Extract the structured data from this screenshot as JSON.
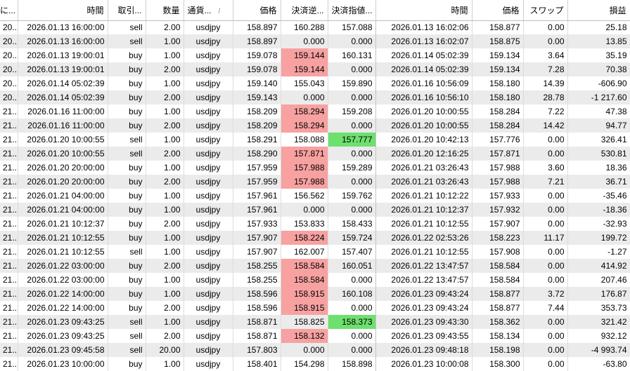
{
  "columns": {
    "order": "に...",
    "time": "時間",
    "type": "取引...",
    "volume": "数量",
    "symbol": "通貨...",
    "sort_glyph": "/",
    "price": "価格",
    "sl": "決済逆...",
    "tp": "決済指値...",
    "close_time": "時間",
    "close_price": "価格",
    "swap": "スワップ",
    "profit": "損益"
  },
  "colors": {
    "stop_loss_highlight": "#f7a1a1",
    "take_profit_highlight": "#6ee06e",
    "alt_row": "#ebebeb"
  },
  "rows": [
    {
      "order": "20...",
      "time": "2026.01.13 16:00:00",
      "type": "sell",
      "volume": "2.00",
      "symbol": "usdjpy",
      "price": "158.897",
      "sl": "160.288",
      "tp": "157.088",
      "close_time": "2026.01.13 16:02:06",
      "close_price": "158.877",
      "swap": "0.00",
      "profit": "25.18",
      "sl_hl": "",
      "tp_hl": ""
    },
    {
      "order": "20...",
      "time": "2026.01.13 16:00:00",
      "type": "sell",
      "volume": "1.00",
      "symbol": "usdjpy",
      "price": "158.897",
      "sl": "0.000",
      "tp": "0.000",
      "close_time": "2026.01.13 16:02:07",
      "close_price": "158.875",
      "swap": "0.00",
      "profit": "13.85",
      "sl_hl": "",
      "tp_hl": ""
    },
    {
      "order": "20...",
      "time": "2026.01.13 19:00:01",
      "type": "buy",
      "volume": "1.00",
      "symbol": "usdjpy",
      "price": "159.078",
      "sl": "159.144",
      "tp": "160.131",
      "close_time": "2026.01.14 05:02:39",
      "close_price": "159.134",
      "swap": "3.64",
      "profit": "35.19",
      "sl_hl": "red",
      "tp_hl": ""
    },
    {
      "order": "20...",
      "time": "2026.01.13 19:00:01",
      "type": "buy",
      "volume": "2.00",
      "symbol": "usdjpy",
      "price": "159.078",
      "sl": "159.144",
      "tp": "0.000",
      "close_time": "2026.01.14 05:02:39",
      "close_price": "159.134",
      "swap": "7.28",
      "profit": "70.38",
      "sl_hl": "red",
      "tp_hl": ""
    },
    {
      "order": "20...",
      "time": "2026.01.14 05:02:39",
      "type": "buy",
      "volume": "1.00",
      "symbol": "usdjpy",
      "price": "159.140",
      "sl": "155.043",
      "tp": "159.890",
      "close_time": "2026.01.16 10:56:09",
      "close_price": "158.180",
      "swap": "14.39",
      "profit": "-606.90",
      "sl_hl": "",
      "tp_hl": ""
    },
    {
      "order": "20...",
      "time": "2026.01.14 05:02:39",
      "type": "buy",
      "volume": "2.00",
      "symbol": "usdjpy",
      "price": "159.143",
      "sl": "0.000",
      "tp": "0.000",
      "close_time": "2026.01.16 10:56:10",
      "close_price": "158.180",
      "swap": "28.78",
      "profit": "-1 217.60",
      "sl_hl": "",
      "tp_hl": ""
    },
    {
      "order": "21...",
      "time": "2026.01.16 11:00:00",
      "type": "buy",
      "volume": "1.00",
      "symbol": "usdjpy",
      "price": "158.209",
      "sl": "158.294",
      "tp": "159.208",
      "close_time": "2026.01.20 10:00:55",
      "close_price": "158.284",
      "swap": "7.22",
      "profit": "47.38",
      "sl_hl": "red",
      "tp_hl": ""
    },
    {
      "order": "21...",
      "time": "2026.01.16 11:00:00",
      "type": "buy",
      "volume": "2.00",
      "symbol": "usdjpy",
      "price": "158.209",
      "sl": "158.294",
      "tp": "0.000",
      "close_time": "2026.01.20 10:00:55",
      "close_price": "158.284",
      "swap": "14.42",
      "profit": "94.77",
      "sl_hl": "red",
      "tp_hl": ""
    },
    {
      "order": "21...",
      "time": "2026.01.20 10:00:55",
      "type": "sell",
      "volume": "1.00",
      "symbol": "usdjpy",
      "price": "158.291",
      "sl": "158.088",
      "tp": "157.777",
      "close_time": "2026.01.20 10:42:13",
      "close_price": "157.776",
      "swap": "0.00",
      "profit": "326.41",
      "sl_hl": "",
      "tp_hl": "green"
    },
    {
      "order": "21...",
      "time": "2026.01.20 10:00:55",
      "type": "sell",
      "volume": "2.00",
      "symbol": "usdjpy",
      "price": "158.290",
      "sl": "157.871",
      "tp": "0.000",
      "close_time": "2026.01.20 12:16:25",
      "close_price": "157.871",
      "swap": "0.00",
      "profit": "530.81",
      "sl_hl": "red",
      "tp_hl": ""
    },
    {
      "order": "21...",
      "time": "2026.01.20 20:00:00",
      "type": "buy",
      "volume": "1.00",
      "symbol": "usdjpy",
      "price": "157.959",
      "sl": "157.988",
      "tp": "159.289",
      "close_time": "2026.01.21 03:26:43",
      "close_price": "157.988",
      "swap": "3.60",
      "profit": "18.36",
      "sl_hl": "red",
      "tp_hl": ""
    },
    {
      "order": "21...",
      "time": "2026.01.20 20:00:00",
      "type": "buy",
      "volume": "2.00",
      "symbol": "usdjpy",
      "price": "157.959",
      "sl": "157.988",
      "tp": "0.000",
      "close_time": "2026.01.21 03:26:43",
      "close_price": "157.988",
      "swap": "7.21",
      "profit": "36.71",
      "sl_hl": "red",
      "tp_hl": ""
    },
    {
      "order": "21...",
      "time": "2026.01.21 04:00:00",
      "type": "buy",
      "volume": "1.00",
      "symbol": "usdjpy",
      "price": "157.961",
      "sl": "156.562",
      "tp": "159.762",
      "close_time": "2026.01.21 10:12:22",
      "close_price": "157.933",
      "swap": "0.00",
      "profit": "-35.46",
      "sl_hl": "",
      "tp_hl": ""
    },
    {
      "order": "21...",
      "time": "2026.01.21 04:00:00",
      "type": "buy",
      "volume": "1.00",
      "symbol": "usdjpy",
      "price": "157.961",
      "sl": "0.000",
      "tp": "0.000",
      "close_time": "2026.01.21 10:12:37",
      "close_price": "157.932",
      "swap": "0.00",
      "profit": "-18.36",
      "sl_hl": "",
      "tp_hl": ""
    },
    {
      "order": "21...",
      "time": "2026.01.21 10:12:37",
      "type": "buy",
      "volume": "2.00",
      "symbol": "usdjpy",
      "price": "157.933",
      "sl": "153.833",
      "tp": "158.433",
      "close_time": "2026.01.21 10:12:55",
      "close_price": "157.907",
      "swap": "0.00",
      "profit": "-32.93",
      "sl_hl": "",
      "tp_hl": ""
    },
    {
      "order": "21...",
      "time": "2026.01.21 10:12:55",
      "type": "buy",
      "volume": "1.00",
      "symbol": "usdjpy",
      "price": "157.907",
      "sl": "158.224",
      "tp": "159.724",
      "close_time": "2026.01.22 02:53:26",
      "close_price": "158.223",
      "swap": "11.17",
      "profit": "199.72",
      "sl_hl": "red",
      "tp_hl": ""
    },
    {
      "order": "21...",
      "time": "2026.01.21 10:12:55",
      "type": "sell",
      "volume": "1.00",
      "symbol": "usdjpy",
      "price": "157.907",
      "sl": "162.007",
      "tp": "157.407",
      "close_time": "2026.01.21 10:12:55",
      "close_price": "157.908",
      "swap": "0.00",
      "profit": "-1.27",
      "sl_hl": "",
      "tp_hl": ""
    },
    {
      "order": "21...",
      "time": "2026.01.22 03:00:00",
      "type": "buy",
      "volume": "2.00",
      "symbol": "usdjpy",
      "price": "158.255",
      "sl": "158.584",
      "tp": "160.051",
      "close_time": "2026.01.22 13:47:57",
      "close_price": "158.584",
      "swap": "0.00",
      "profit": "414.92",
      "sl_hl": "red",
      "tp_hl": ""
    },
    {
      "order": "21...",
      "time": "2026.01.22 03:00:00",
      "type": "buy",
      "volume": "1.00",
      "symbol": "usdjpy",
      "price": "158.255",
      "sl": "158.584",
      "tp": "0.000",
      "close_time": "2026.01.22 13:47:57",
      "close_price": "158.584",
      "swap": "0.00",
      "profit": "207.46",
      "sl_hl": "red",
      "tp_hl": ""
    },
    {
      "order": "21...",
      "time": "2026.01.22 14:00:00",
      "type": "buy",
      "volume": "1.00",
      "symbol": "usdjpy",
      "price": "158.596",
      "sl": "158.915",
      "tp": "160.108",
      "close_time": "2026.01.23 09:43:24",
      "close_price": "158.877",
      "swap": "3.72",
      "profit": "176.87",
      "sl_hl": "red",
      "tp_hl": ""
    },
    {
      "order": "21...",
      "time": "2026.01.22 14:00:00",
      "type": "buy",
      "volume": "2.00",
      "symbol": "usdjpy",
      "price": "158.596",
      "sl": "158.915",
      "tp": "0.000",
      "close_time": "2026.01.23 09:43:24",
      "close_price": "158.877",
      "swap": "7.44",
      "profit": "353.73",
      "sl_hl": "red",
      "tp_hl": ""
    },
    {
      "order": "21...",
      "time": "2026.01.23 09:43:25",
      "type": "sell",
      "volume": "1.00",
      "symbol": "usdjpy",
      "price": "158.871",
      "sl": "158.825",
      "tp": "158.373",
      "close_time": "2026.01.23 09:43:30",
      "close_price": "158.362",
      "swap": "0.00",
      "profit": "321.42",
      "sl_hl": "",
      "tp_hl": "green"
    },
    {
      "order": "21...",
      "time": "2026.01.23 09:43:25",
      "type": "sell",
      "volume": "2.00",
      "symbol": "usdjpy",
      "price": "158.871",
      "sl": "158.132",
      "tp": "0.000",
      "close_time": "2026.01.23 09:43:55",
      "close_price": "158.134",
      "swap": "0.00",
      "profit": "932.12",
      "sl_hl": "red",
      "tp_hl": ""
    },
    {
      "order": "21...",
      "time": "2026.01.23 09:45:58",
      "type": "sell",
      "volume": "20.00",
      "symbol": "usdjpy",
      "price": "157.803",
      "sl": "0.000",
      "tp": "0.000",
      "close_time": "2026.01.23 09:48:18",
      "close_price": "158.198",
      "swap": "0.00",
      "profit": "-4 993.74",
      "sl_hl": "",
      "tp_hl": ""
    },
    {
      "order": "21...",
      "time": "2026.01.23 10:00:00",
      "type": "buy",
      "volume": "1.00",
      "symbol": "usdjpy",
      "price": "158.401",
      "sl": "154.298",
      "tp": "158.898",
      "close_time": "2026.01.23 10:00:08",
      "close_price": "158.300",
      "swap": "0.00",
      "profit": "-63.80",
      "sl_hl": "",
      "tp_hl": ""
    }
  ]
}
